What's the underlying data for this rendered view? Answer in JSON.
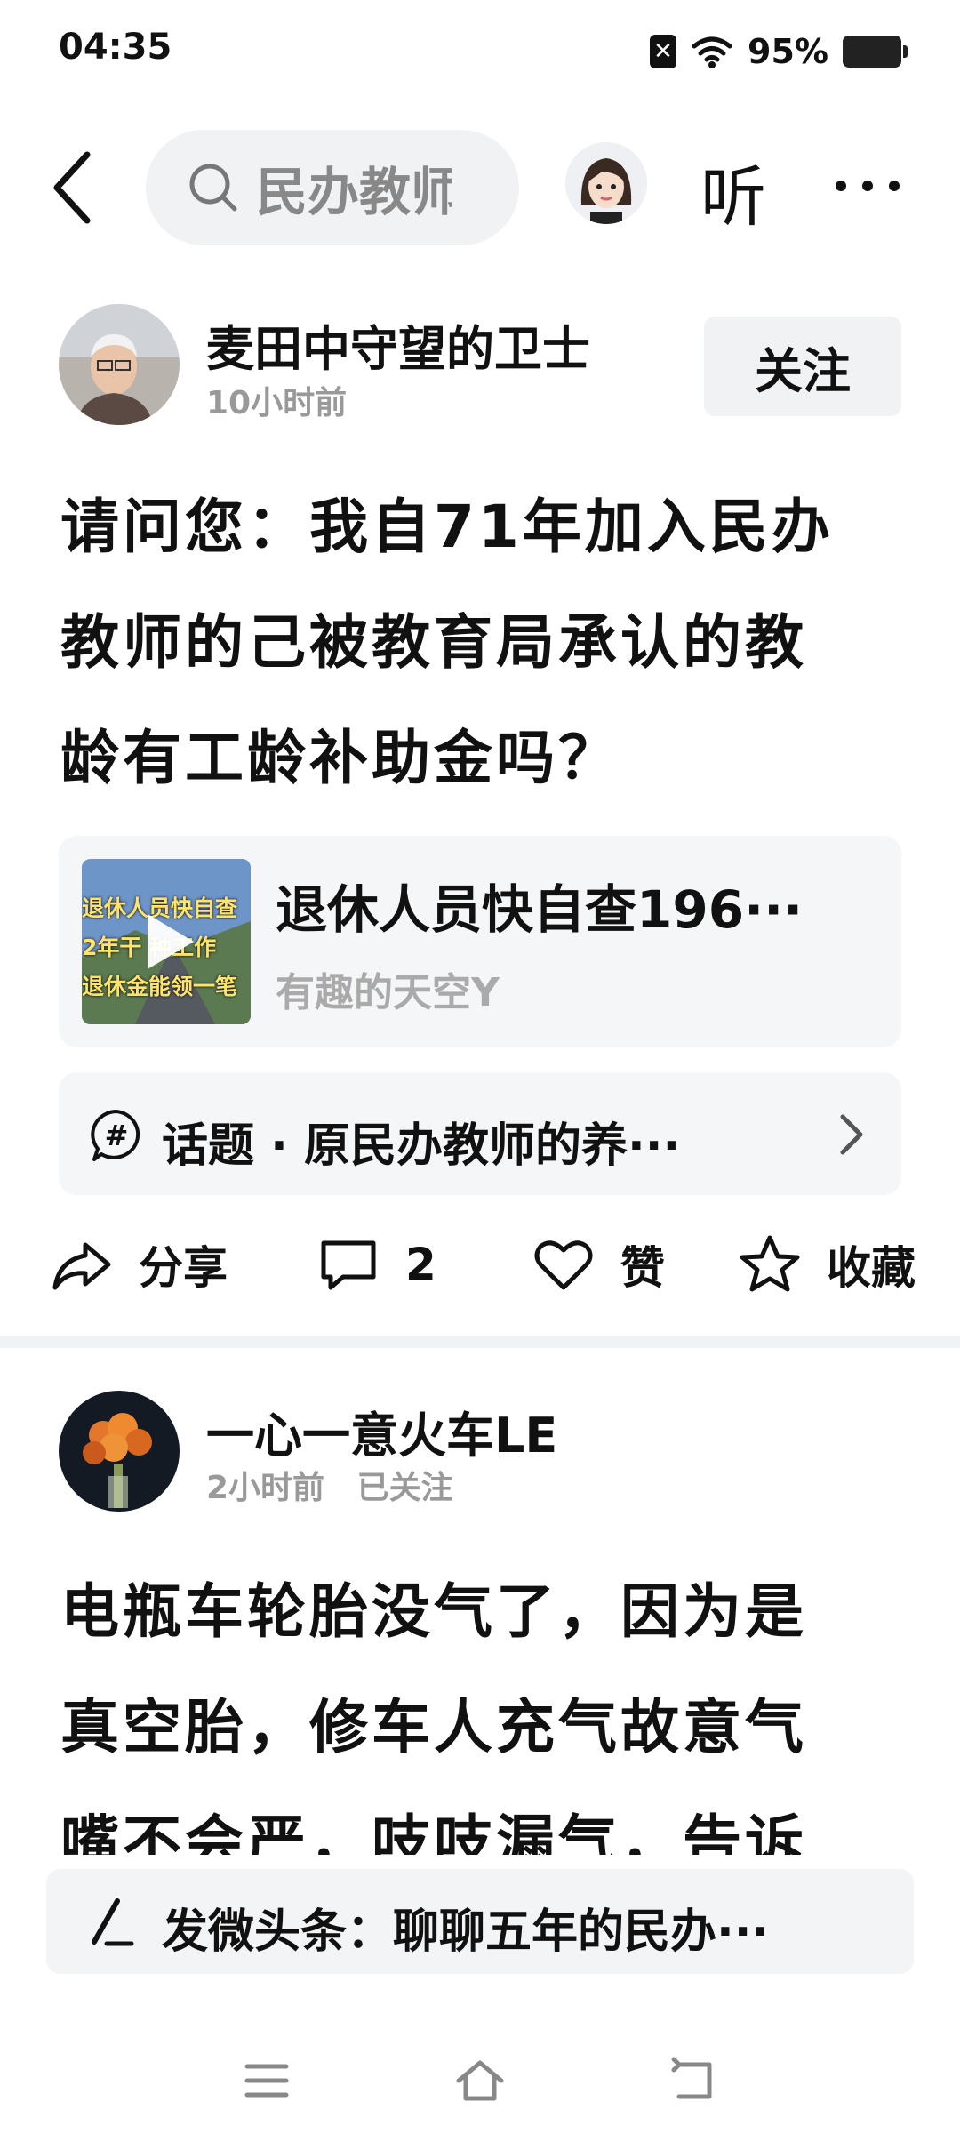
{
  "status_bar": {
    "time": "04:35",
    "battery": "95%"
  },
  "header": {
    "search_text": "民办教师",
    "listen_label": "听"
  },
  "post1": {
    "author": "麦田中守望的卫士",
    "time": "10小时前",
    "follow_label": "关注",
    "title_lines": [
      "请问您：我自71年加入民办",
      "教师的己被教育局承认的教",
      "龄有工龄补助金吗？"
    ],
    "video": {
      "title": "退休人员快自查196···",
      "author": "有趣的天空Y",
      "thumb_lines": [
        "退休人员快自查",
        "2年干  种工作",
        "退休金能领一笔"
      ]
    },
    "topic": "话题 · 原民办教师的养···",
    "actions": {
      "share": "分享",
      "comments": "2",
      "like": "赞",
      "favorite": "收藏"
    }
  },
  "post2": {
    "author": "一心一意火车LE",
    "time": "2小时前",
    "followed": "已关注",
    "title_lines": [
      "电瓶车轮胎没气了，因为是",
      "真空胎，修车人充气故意气",
      "嘴不会严，吱吱漏气，告诉"
    ]
  },
  "compose": {
    "label": "发微头条：聊聊五年的民办···"
  },
  "colors": {
    "accent_bg": "#f5f6f8",
    "meta_gray": "#999999"
  }
}
